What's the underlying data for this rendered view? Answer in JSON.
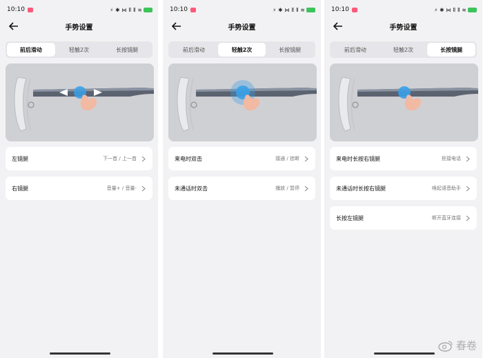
{
  "screens": [
    {
      "status": {
        "time": "10:10",
        "icons": "⚡ ✱ ⋈ Ⅱ Ⅱ ≋",
        "battery": "▮"
      },
      "title": "手势设置",
      "tabs": [
        {
          "label": "前后滑动"
        },
        {
          "label": "轻触2次"
        },
        {
          "label": "长按镜腿"
        }
      ],
      "active_tab": 0,
      "rows": [
        {
          "label": "左镜腿",
          "value": "下一首 / 上一首"
        },
        {
          "label": "右镜腿",
          "value": "音量+ / 音量-"
        }
      ]
    },
    {
      "status": {
        "time": "10:10",
        "icons": "⚡ ✱ ⋈ Ⅱ Ⅱ ≋",
        "battery": "▮"
      },
      "title": "手势设置",
      "tabs": [
        {
          "label": "前后滑动"
        },
        {
          "label": "轻触2次"
        },
        {
          "label": "长按镜腿"
        }
      ],
      "active_tab": 1,
      "rows": [
        {
          "label": "来电时双击",
          "value": "接通 / 挂断"
        },
        {
          "label": "未通话时双击",
          "value": "播放 / 暂停"
        }
      ]
    },
    {
      "status": {
        "time": "10:10",
        "icons": "⚡ ✱ ⋈ Ⅱ Ⅱ ≋",
        "battery": "▮"
      },
      "title": "手势设置",
      "tabs": [
        {
          "label": "前后滑动"
        },
        {
          "label": "轻触2次"
        },
        {
          "label": "长按镜腿"
        }
      ],
      "active_tab": 2,
      "rows": [
        {
          "label": "来电时长按右镜腿",
          "value": "拒接电话"
        },
        {
          "label": "未通话时长按右镜腿",
          "value": "唤起语音助手"
        },
        {
          "label": "长按左镜腿",
          "value": "断开蓝牙连接"
        }
      ]
    }
  ],
  "watermark": {
    "text": "春卷"
  },
  "colors": {
    "accent_blue": "#3aa0e8",
    "finger": "#f2b9a3",
    "preview_bg": "#cfd0d4",
    "battery": "#3cc45a"
  }
}
